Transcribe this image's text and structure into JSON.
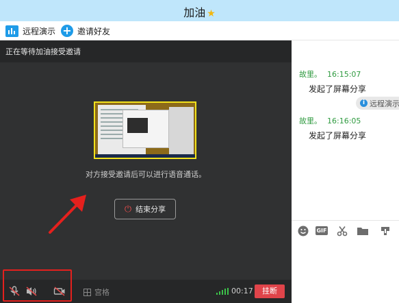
{
  "window": {
    "title": "加油"
  },
  "toolbar": {
    "remote_demo": "远程演示",
    "invite_friend": "邀请好友"
  },
  "share": {
    "status": "正在等待加油接受邀请",
    "hint": "对方接受邀请后可以进行语音通话。",
    "end_share": "结束分享"
  },
  "controls": {
    "grid_label": "宫格",
    "timer": "00:17",
    "hangup": "挂断"
  },
  "chat": {
    "messages": [
      {
        "sender": "故里。",
        "time": "16:15:07",
        "text": "发起了屏幕分享"
      },
      {
        "sender": "故里。",
        "time": "16:16:05",
        "text": "发起了屏幕分享"
      }
    ],
    "system_notice": "远程演示"
  },
  "colors": {
    "titlebar": "#bfe6fb",
    "accent_blue": "#1e9be8",
    "hangup_red": "#e0444a",
    "sender_green": "#2e9a3f",
    "highlight_frame": "#f2e21c"
  },
  "icons": [
    "star-icon",
    "remote-demo-icon",
    "plus-circle-icon",
    "power-icon",
    "mic-muted-icon",
    "speaker-muted-icon",
    "camera-off-icon",
    "grid-icon",
    "signal-icon",
    "info-icon",
    "emoji-icon",
    "gif-icon",
    "scissors-icon",
    "folder-icon",
    "remote-control-icon"
  ]
}
